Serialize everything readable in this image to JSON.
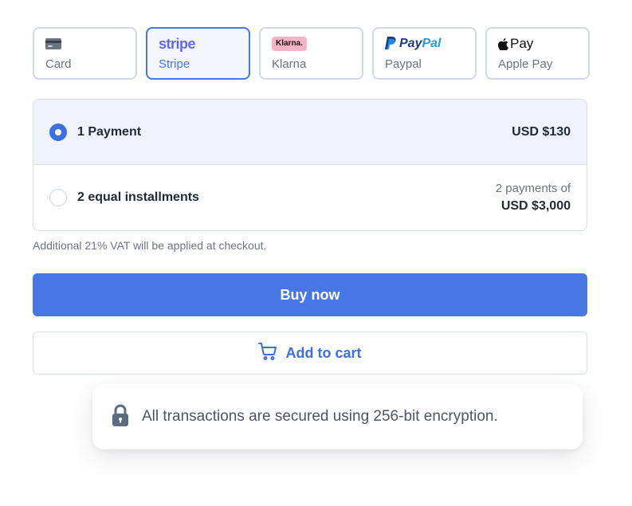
{
  "payment_methods": [
    {
      "id": "card",
      "label": "Card",
      "icon": "credit-card-icon"
    },
    {
      "id": "stripe",
      "label": "Stripe",
      "logo_text": "stripe",
      "selected": true
    },
    {
      "id": "klarna",
      "label": "Klarna",
      "logo_text": "Klarna."
    },
    {
      "id": "paypal",
      "label": "Paypal",
      "logo_text_1": "Pay",
      "logo_text_2": "Pal"
    },
    {
      "id": "applepay",
      "label": "Apple Pay",
      "logo_text": "Pay"
    }
  ],
  "plans": [
    {
      "name": "1 Payment",
      "price": "USD $130",
      "selected": true
    },
    {
      "name": "2 equal installments",
      "note": "2 payments of",
      "price": "USD $3,000",
      "selected": false
    }
  ],
  "vat_note": "Additional 21% VAT will be applied at checkout.",
  "buy_label": "Buy now",
  "cart_label": "Add to cart",
  "security_text": "All transactions are secured using 256-bit encryption.",
  "colors": {
    "accent": "#4677e4",
    "selected_bg": "#eef3fd",
    "border": "#d6dfee",
    "klarna_pink": "#f9b3c7",
    "stripe_purple": "#6366f1"
  }
}
